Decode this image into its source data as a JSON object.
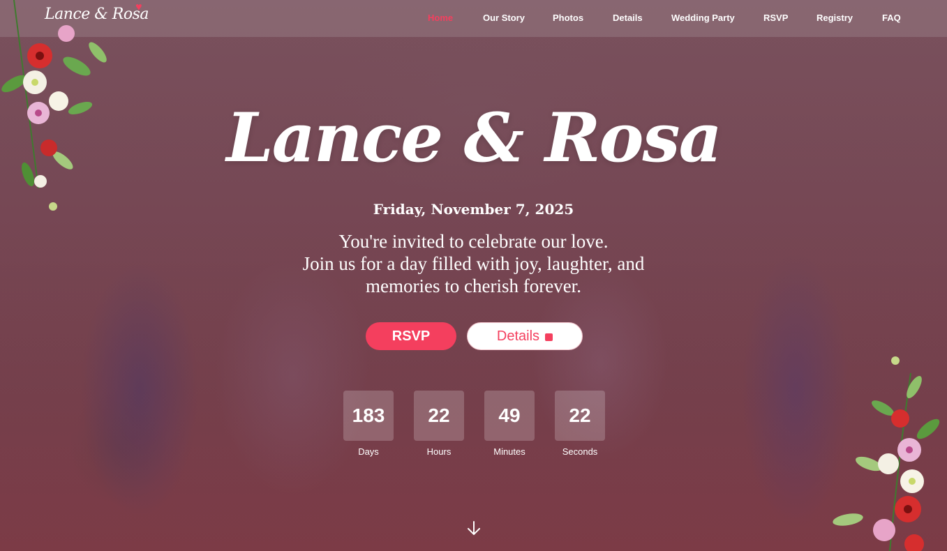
{
  "nav": {
    "brand": "Lance & Rosa",
    "links": [
      {
        "label": "Home",
        "active": true
      },
      {
        "label": "Our Story",
        "active": false
      },
      {
        "label": "Photos",
        "active": false
      },
      {
        "label": "Details",
        "active": false
      },
      {
        "label": "Wedding Party",
        "active": false
      },
      {
        "label": "RSVP",
        "active": false
      },
      {
        "label": "Registry",
        "active": false
      },
      {
        "label": "FAQ",
        "active": false
      }
    ]
  },
  "hero": {
    "title": "Lance & Rosa",
    "date": "Friday, November 7, 2025",
    "message_line1": "You're invited to celebrate our love.",
    "message_line2": "Join us for a day filled with joy, laughter, and",
    "message_line3": "memories to cherish forever.",
    "rsvp_button": "RSVP",
    "details_button": "Details",
    "details_icon": "calendar-icon"
  },
  "countdown": [
    {
      "value": "183",
      "label": "Days"
    },
    {
      "value": "22",
      "label": "Hours"
    },
    {
      "value": "49",
      "label": "Minutes"
    },
    {
      "value": "22",
      "label": "Seconds"
    }
  ],
  "colors": {
    "accent": "#f43f5e",
    "overlay": "#744b57"
  },
  "icons": {
    "scroll": "arrow-down-icon",
    "brand_heart": "heart-icon",
    "decor": "floral-decoration"
  }
}
